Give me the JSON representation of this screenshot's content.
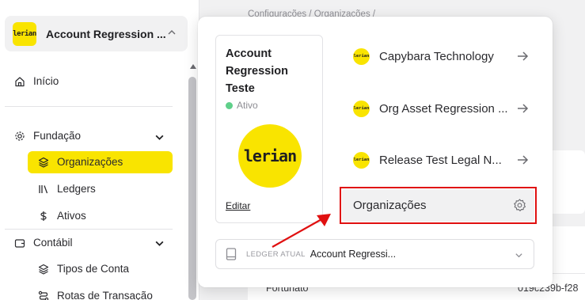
{
  "sidebar": {
    "org_switcher": {
      "logo_text": "lerian",
      "name": "Account Regression ..."
    },
    "items": {
      "home": "Início",
      "foundation": "Fundação",
      "organizations": "Organizações",
      "ledgers": "Ledgers",
      "assets": "Ativos",
      "accounting": "Contábil",
      "account_types": "Tipos de Conta",
      "transaction_routes": "Rotas de Transação"
    }
  },
  "background": {
    "breadcrumb": "Configurações  /  Organizações  /",
    "row": {
      "name": "Fortunato",
      "id": "019c239b-f28"
    }
  },
  "popover": {
    "current_org": {
      "name": "Account Regression Teste",
      "status": "Ativo",
      "logo_text": "lerian",
      "edit_label": "Editar"
    },
    "organizations": [
      {
        "logo_text": "lerian",
        "name": "Capybara Technology"
      },
      {
        "logo_text": "lerian",
        "name": "Org Asset Regression ..."
      },
      {
        "logo_text": "lerian",
        "name": "Release Test Legal N..."
      }
    ],
    "manage_label": "Organizações",
    "ledger": {
      "caption": "LEDGER ATUAL",
      "value": "Account Regressi..."
    }
  },
  "colors": {
    "brand_yellow": "#f9e400",
    "status_green": "#5fd08a",
    "highlight_red": "#e01010"
  }
}
